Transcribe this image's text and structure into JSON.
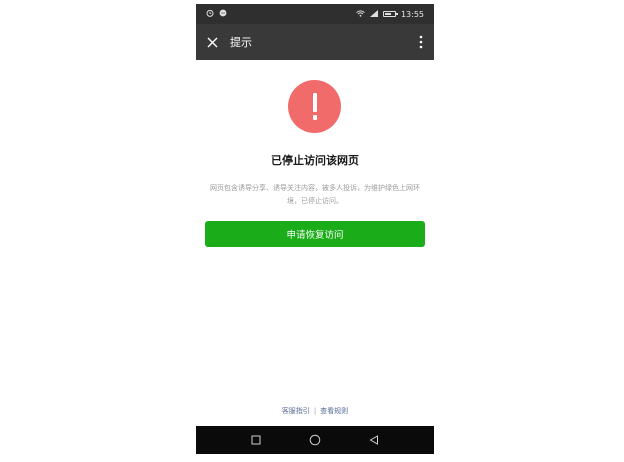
{
  "status_bar": {
    "time": "13:55",
    "left_icons": [
      "alarm-icon",
      "notification-icon"
    ],
    "right_icons": [
      "wifi-icon",
      "signal-icon",
      "battery-icon"
    ]
  },
  "app_bar": {
    "title": "提示",
    "close_icon": "close-icon",
    "more_icon": "more-vertical-icon"
  },
  "alert": {
    "icon": "exclamation-icon",
    "color": "#f26b6b",
    "title": "已停止访问该网页",
    "description": "网页包含诱导分享、诱导关注内容，被多人投诉，为维护绿色上网环境，已停止访问。"
  },
  "actions": {
    "primary_label": "申请恢复访问",
    "primary_color": "#1aad19"
  },
  "footer": {
    "link_1": "客服指引",
    "separator": "|",
    "link_2": "查看规则"
  },
  "nav_bar": {
    "icons": [
      "recent-apps-icon",
      "home-icon",
      "back-icon"
    ]
  }
}
